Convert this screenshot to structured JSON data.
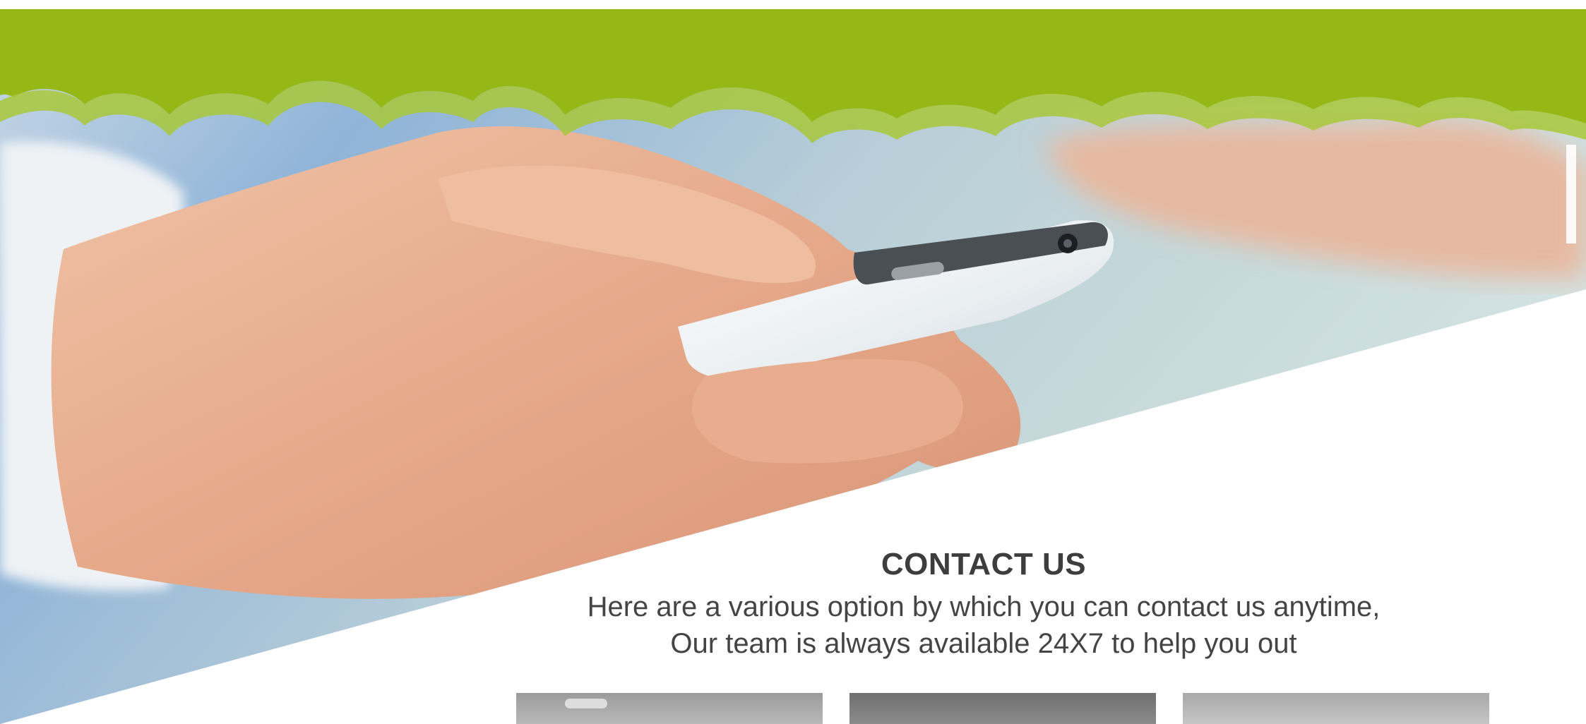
{
  "contact": {
    "title": "CONTACT US",
    "subtitle_line1": "Here are a various option by which you can contact us anytime,",
    "subtitle_line2": "Our team is always available 24X7 to help you out"
  },
  "colors": {
    "header_green": "#95b817",
    "header_green_light": "#a8c83a",
    "title_text": "#3d3d3d",
    "body_text": "#444444",
    "background": "#ffffff"
  },
  "hero_image": {
    "subject": "hand holding white smartphone"
  },
  "cards": [
    {
      "name": "contact-card-1",
      "tone": "light-gray"
    },
    {
      "name": "contact-card-2",
      "tone": "dark-gray"
    },
    {
      "name": "contact-card-3",
      "tone": "light-gray"
    }
  ]
}
